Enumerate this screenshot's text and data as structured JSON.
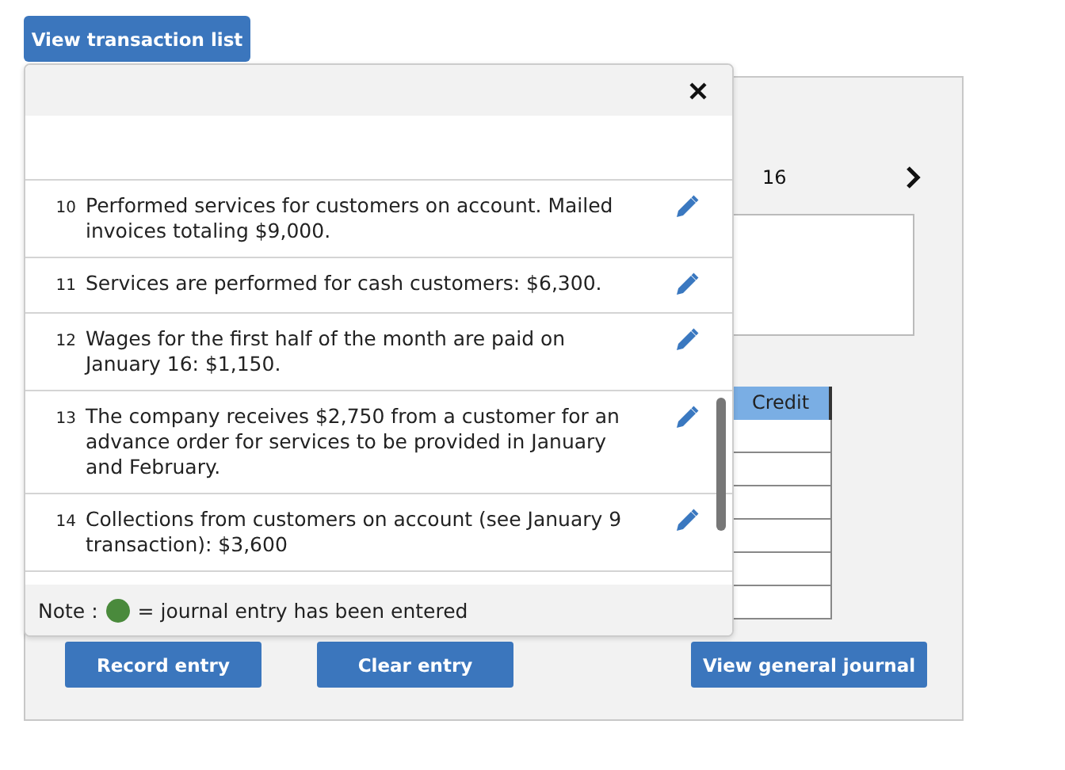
{
  "top_button": "View transaction list",
  "popover": {
    "transactions": [
      {
        "number": "10",
        "text": "Performed services for customers on account. Mailed invoices totaling $9,000."
      },
      {
        "number": "11",
        "text": "Services are performed for cash customers: $6,300."
      },
      {
        "number": "12",
        "text": "Wages for the first half of the month are paid on January 16: $1,150."
      },
      {
        "number": "13",
        "text": "The company receives $2,750 from a customer for an advance order for services to be provided in January and February."
      },
      {
        "number": "14",
        "text": "Collections from customers on account (see January 9 transaction): $3,600"
      }
    ],
    "note": {
      "label": "Note :",
      "text": "= journal entry has been entered"
    }
  },
  "journal": {
    "date": "16",
    "table": {
      "columns": [
        "Credit"
      ]
    }
  },
  "buttons": [
    "Record entry",
    "Clear entry",
    "View general journal"
  ]
}
